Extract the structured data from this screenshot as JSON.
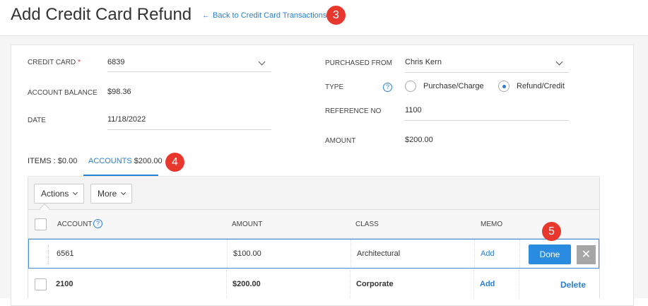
{
  "header": {
    "title": "Add Credit Card Refund",
    "back_link": "Back to Credit Card Transactions",
    "back_arrow": "←"
  },
  "markers": [
    "3",
    "4",
    "5"
  ],
  "form": {
    "credit_card": {
      "label": "CREDIT CARD",
      "required_mark": "*",
      "value": "6839"
    },
    "account_balance": {
      "label": "ACCOUNT BALANCE",
      "value": "$98.36"
    },
    "date": {
      "label": "DATE",
      "value": "11/18/2022"
    },
    "purchased_from": {
      "label": "PURCHASED FROM",
      "value": "Chris Kern"
    },
    "type": {
      "label": "TYPE",
      "help": "?",
      "options": [
        "Purchase/Charge",
        "Refund/Credit"
      ],
      "selected": "Refund/Credit"
    },
    "reference_no": {
      "label": "REFERENCE NO",
      "value": "1100"
    },
    "amount": {
      "label": "AMOUNT",
      "value": "$200.00"
    }
  },
  "tabs": {
    "items_label": "ITEMS : $0.00",
    "accounts_label": "ACCOUNTS",
    "accounts_amount": "$200.00",
    "active": "accounts"
  },
  "toolbar": {
    "actions": "Actions",
    "more": "More"
  },
  "table": {
    "columns": [
      "ACCOUNT",
      "AMOUNT",
      "CLASS",
      "MEMO"
    ],
    "account_help": "?",
    "rows": [
      {
        "account": "6561",
        "amount": "$100.00",
        "class": "Architectural",
        "memo": "Add"
      },
      {
        "account": "2100",
        "amount": "$200.00",
        "class": "Corporate",
        "memo": "Add"
      }
    ],
    "done_label": "Done",
    "close_label": "✕",
    "delete_label": "Delete"
  },
  "colors": {
    "accent": "#2a7fd4",
    "marker": "#e8382d",
    "done": "#2a8ce0"
  }
}
